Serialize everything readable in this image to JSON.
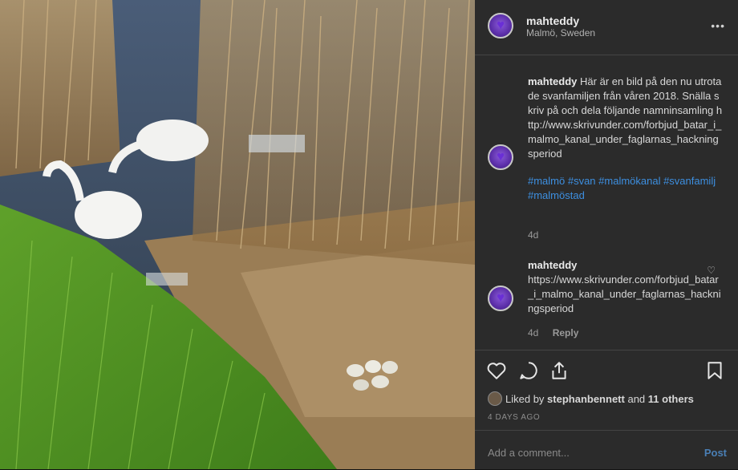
{
  "post": {
    "username": "mahteddy",
    "location": "Malmö, Sweden"
  },
  "comments": [
    {
      "username": "mahteddy",
      "text": "Här är en bild på den nu utrotade svanfamiljen från våren 2018. Snälla skriv på och dela följande namninsamling http://www.skrivunder.com/forbjud_batar_i_malmo_kanal_under_faglarnas_hackningsperiod",
      "hashtags": "#malmö #svan #malmökanal #svanfamilj #malmöstad",
      "age": "4d"
    },
    {
      "username": "mahteddy",
      "text": "https://www.skrivunder.com/forbjud_batar_i_malmo_kanal_under_faglarnas_hackningsperiod",
      "age": "4d",
      "reply_label": "Reply"
    }
  ],
  "likes": {
    "prefix": "Liked by",
    "user": "stephanbennett",
    "and": "and",
    "others": "11 others"
  },
  "time_ago": "4 DAYS AGO",
  "add_comment": {
    "placeholder": "Add a comment...",
    "post_label": "Post"
  },
  "colors": {
    "hashtag": "#3d8fe0",
    "avatar": "#6a2fd6"
  }
}
